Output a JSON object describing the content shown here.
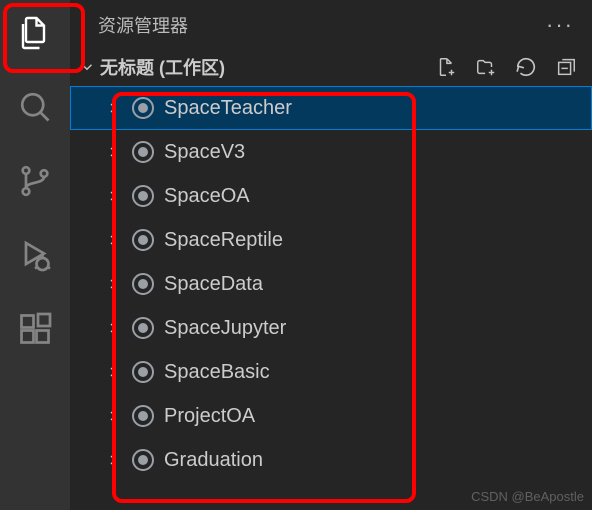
{
  "sidebar": {
    "title": "资源管理器",
    "section_title": "无标题 (工作区)"
  },
  "tree": {
    "items": [
      {
        "label": "SpaceTeacher"
      },
      {
        "label": "SpaceV3"
      },
      {
        "label": "SpaceOA"
      },
      {
        "label": "SpaceReptile"
      },
      {
        "label": "SpaceData"
      },
      {
        "label": "SpaceJupyter"
      },
      {
        "label": "SpaceBasic"
      },
      {
        "label": "ProjectOA"
      },
      {
        "label": "Graduation"
      }
    ]
  },
  "watermark": "CSDN @BeApostle"
}
